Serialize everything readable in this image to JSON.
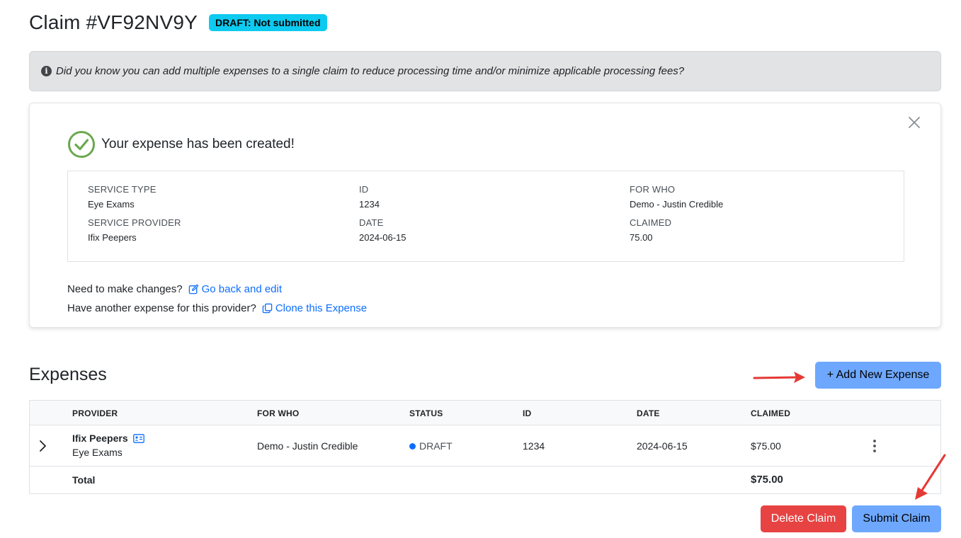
{
  "header": {
    "title": "Claim #VF92NV9Y",
    "badge": "DRAFT: Not submitted"
  },
  "info_alert": {
    "icon": "info-circle-icon",
    "text": "Did you know you can add multiple expenses to a single claim to reduce processing time and/or minimize applicable processing fees?"
  },
  "success_card": {
    "heading": "Your expense has been created!",
    "details": {
      "service_type_label": "SERVICE TYPE",
      "service_type_value": "Eye Exams",
      "service_provider_label": "SERVICE PROVIDER",
      "service_provider_value": "Ifix Peepers",
      "id_label": "ID",
      "id_value": "1234",
      "date_label": "DATE",
      "date_value": "2024-06-15",
      "for_who_label": "FOR WHO",
      "for_who_value": "Demo - Justin Credible",
      "claimed_label": "CLAIMED",
      "claimed_value": "75.00"
    },
    "changes_prompt": "Need to make changes?",
    "edit_link": "Go back and edit",
    "clone_prompt": "Have another expense for this provider?",
    "clone_link": "Clone this Expense"
  },
  "expenses": {
    "title": "Expenses",
    "add_button": "+ Add New Expense",
    "columns": [
      "PROVIDER",
      "FOR WHO",
      "STATUS",
      "ID",
      "DATE",
      "CLAIMED"
    ],
    "rows": [
      {
        "provider": "Ifix Peepers",
        "service": "Eye Exams",
        "for_who": "Demo - Justin Credible",
        "status": "DRAFT",
        "id": "1234",
        "date": "2024-06-15",
        "claimed": "$75.00"
      }
    ],
    "total_label": "Total",
    "total_value": "$75.00"
  },
  "actions": {
    "delete_button": "Delete Claim",
    "submit_button": "Submit Claim"
  },
  "colors": {
    "badge": "#0dcaf0",
    "primary_button": "#6ea8fe",
    "danger_button": "#e74343",
    "link": "#0d6efd",
    "success_check": "#6aa84f",
    "annotation_arrow": "#e53935"
  }
}
